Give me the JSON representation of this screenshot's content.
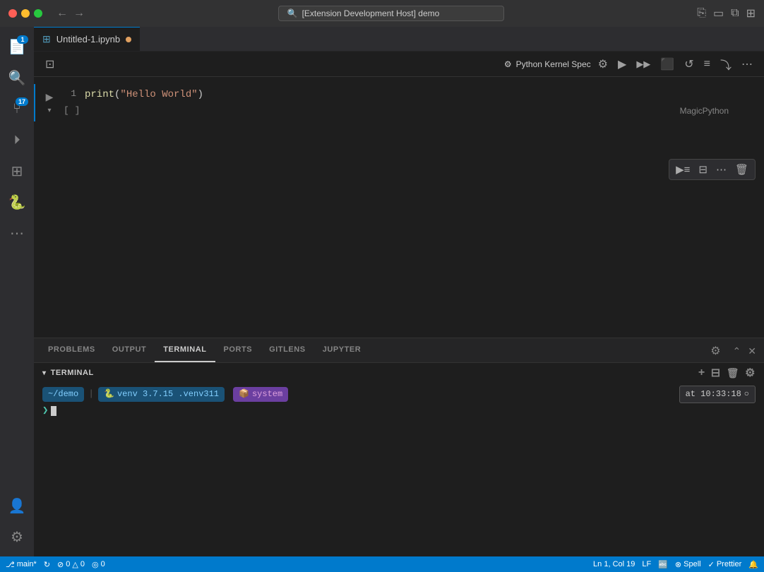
{
  "titlebar": {
    "search_text": "[Extension Development Host] demo",
    "back_arrow": "←",
    "forward_arrow": "→"
  },
  "tab": {
    "filename": "Untitled-1.ipynb",
    "modified": true
  },
  "notebook_toolbar": {
    "kernel_icon": "⚙",
    "kernel_name": "Python Kernel Spec",
    "run_icon": "▶",
    "run_all_icon": "▶▶",
    "interrupt_icon": "⬛",
    "restart_icon": "↺",
    "outline_icon": "≡",
    "more_icon": "⋯"
  },
  "cell": {
    "code": "print(\"Hello World\")",
    "line_number": "1",
    "output_bracket": "[ ]",
    "language": "MagicPython"
  },
  "cell_toolbar": {
    "execute_icon": "▶",
    "split_icon": "⊟",
    "more_icon": "⋯",
    "delete_icon": "🗑"
  },
  "panel": {
    "tabs": [
      "PROBLEMS",
      "OUTPUT",
      "TERMINAL",
      "PORTS",
      "GITLENS",
      "JUPYTER"
    ],
    "active_tab": "TERMINAL"
  },
  "terminal": {
    "header": "TERMINAL",
    "path": "~/demo",
    "venv_emoji": "🐍",
    "venv_label": "venv 3.7.15 .venv311",
    "system_emoji": "📦",
    "system_label": "system",
    "time": "at 10:33:18",
    "clock_icon": "○",
    "prompt": "❯"
  },
  "activity_bar": {
    "explorer_icon": "⊡",
    "search_icon": "🔍",
    "source_control_icon": "⑂",
    "source_control_badge": "17",
    "debug_icon": "⏵",
    "extensions_icon": "⊞",
    "more_icon": "⋯",
    "accounts_icon": "👤",
    "settings_icon": "⚙",
    "python_icon": "🐍",
    "explorer_badge": "1"
  },
  "status_bar": {
    "branch_icon": "⎇",
    "branch_name": "main*",
    "sync_icon": "↻",
    "errors_icon": "⊘",
    "errors": "0",
    "warnings_icon": "△",
    "warnings": "0",
    "radio_icon": "◎",
    "radio": "0",
    "cursor_pos": "Ln 1, Col 19",
    "line_ending": "LF",
    "encoding_icon": "🔤",
    "encoding": "",
    "spell_icon": "⊗",
    "spell": "Spell",
    "prettier_icon": "✓",
    "prettier": "Prettier",
    "notification_icon": "🔔"
  }
}
